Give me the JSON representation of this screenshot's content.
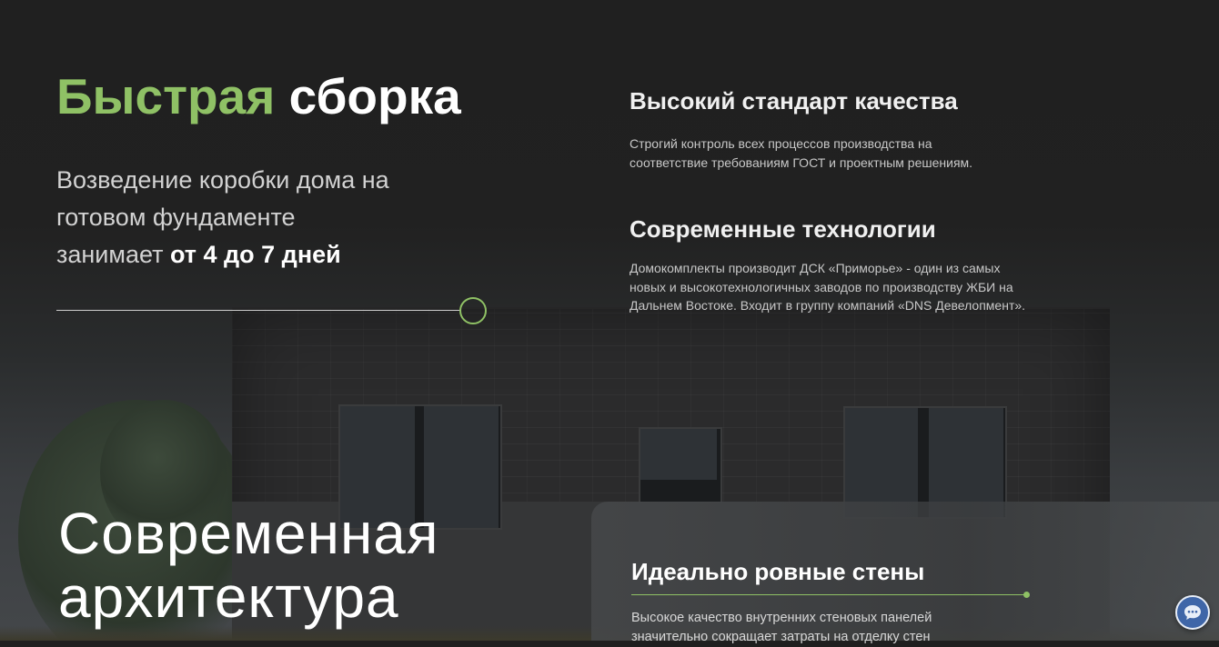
{
  "colors": {
    "accent": "#8fc165",
    "background": "#1f1f1f",
    "chat_button": "#3f66a8"
  },
  "hero": {
    "title_accent": "Быстрая",
    "title_rest": "сборка",
    "subtitle_line1": "Возведение коробки дома на",
    "subtitle_line2": "готовом фундаменте",
    "subtitle_line3_prefix": "занимает",
    "subtitle_highlight": "от 4 до 7 дней"
  },
  "features": [
    {
      "title": "Высокий стандарт качества",
      "text_line1": "Строгий контроль всех процессов производства на",
      "text_line2": "соответствие требованиям ГОСТ и проектным решениям."
    },
    {
      "title": "Современные технологии",
      "text_line1": "Домокомплекты производит ДСК «Приморье» - один из самых",
      "text_line2": "новых и высокотехнологичных заводов по производству ЖБИ на",
      "text_line3": "Дальнем Востоке. Входит в группу компаний «DNS Девелопмент»."
    }
  ],
  "architecture": {
    "line1": "Современная",
    "line2": "архитектура"
  },
  "panel": {
    "title": "Идеально ровные стены",
    "text_line1": "Высокое качество внутренних стеновых панелей",
    "text_line2": "значительно сокращает затраты на отделку стен"
  },
  "chat": {
    "icon": "chat-bubble-icon"
  }
}
